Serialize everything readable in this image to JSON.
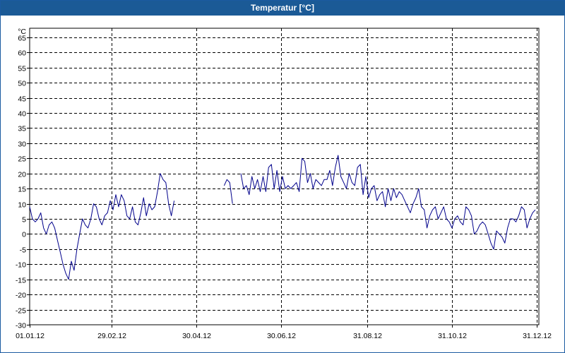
{
  "window": {
    "title": "Temperatur [°C]"
  },
  "chart_data": {
    "type": "line",
    "title": "Temperatur [°C]",
    "ylabel": "°C",
    "xlabel": "",
    "ylim": [
      -30,
      68
    ],
    "yticks": [
      -30,
      -25,
      -20,
      -15,
      -10,
      -5,
      0,
      5,
      10,
      15,
      20,
      25,
      30,
      35,
      40,
      45,
      50,
      55,
      60,
      65
    ],
    "xlim": [
      "2012-01-01",
      "2012-12-31"
    ],
    "xticks": [
      {
        "date": "2012-01-01",
        "label": "01.01.12"
      },
      {
        "date": "2012-02-29",
        "label": "29.02.12"
      },
      {
        "date": "2012-04-30",
        "label": "30.04.12"
      },
      {
        "date": "2012-06-30",
        "label": "30.06.12"
      },
      {
        "date": "2012-08-31",
        "label": "31.08.12"
      },
      {
        "date": "2012-10-31",
        "label": "31.10.12"
      },
      {
        "date": "2012-12-31",
        "label": "31.12.12"
      }
    ],
    "grid": true,
    "grid_style": "dashed",
    "line_color": "#00008b",
    "series": [
      {
        "segments": [
          {
            "x": [
              "2012-01-01",
              "2012-01-03",
              "2012-01-05",
              "2012-01-07",
              "2012-01-09",
              "2012-01-11",
              "2012-01-13",
              "2012-01-15",
              "2012-01-17",
              "2012-01-19",
              "2012-01-21",
              "2012-01-23",
              "2012-01-25",
              "2012-01-27",
              "2012-01-29",
              "2012-01-31",
              "2012-02-02",
              "2012-02-04",
              "2012-02-06",
              "2012-02-08",
              "2012-02-10",
              "2012-02-12",
              "2012-02-14",
              "2012-02-16",
              "2012-02-18",
              "2012-02-20",
              "2012-02-22",
              "2012-02-24",
              "2012-02-26",
              "2012-02-28",
              "2012-03-01",
              "2012-03-03",
              "2012-03-05",
              "2012-03-07",
              "2012-03-09",
              "2012-03-11",
              "2012-03-13",
              "2012-03-15",
              "2012-03-17",
              "2012-03-19",
              "2012-03-21",
              "2012-03-23",
              "2012-03-25",
              "2012-03-27",
              "2012-03-29",
              "2012-03-31",
              "2012-04-02",
              "2012-04-04",
              "2012-04-06",
              "2012-04-08",
              "2012-04-10",
              "2012-04-12",
              "2012-04-14",
              "2012-04-16",
              "2012-04-18",
              "2012-04-20",
              "2012-04-22",
              "2012-04-24",
              "2012-04-26",
              "2012-04-28",
              "2012-04-30",
              "2012-05-02",
              "2012-05-04",
              "2012-05-06",
              "2012-05-08",
              "2012-05-10"
            ],
            "y": [
              9,
              5,
              4,
              5,
              7,
              2,
              0,
              3,
              4,
              2,
              -2,
              -6,
              -10,
              -13,
              -15,
              -9,
              -12,
              -5,
              0,
              5,
              3,
              2,
              5,
              10,
              9,
              5,
              3,
              6,
              7,
              11,
              8,
              13,
              9,
              13,
              11,
              6,
              5,
              9,
              4,
              3,
              7,
              12,
              6,
              10,
              8,
              9,
              14,
              20,
              18,
              17,
              10,
              6,
              11,
              null,
              null,
              null,
              null,
              null,
              null,
              null,
              null,
              null,
              null,
              null,
              null,
              null
            ]
          },
          {
            "x": [
              "2012-05-20",
              "2012-05-22",
              "2012-05-24",
              "2012-05-26"
            ],
            "y": [
              16,
              18,
              17,
              10
            ]
          },
          {
            "x": [
              "2012-06-01",
              "2012-06-03",
              "2012-06-05",
              "2012-06-07",
              "2012-06-09",
              "2012-06-11",
              "2012-06-13",
              "2012-06-15",
              "2012-06-17",
              "2012-06-19",
              "2012-06-21",
              "2012-06-23",
              "2012-06-25",
              "2012-06-27",
              "2012-06-29",
              "2012-07-01",
              "2012-07-03",
              "2012-07-05",
              "2012-07-07",
              "2012-07-09",
              "2012-07-11",
              "2012-07-13",
              "2012-07-15",
              "2012-07-17",
              "2012-07-19",
              "2012-07-21",
              "2012-07-23",
              "2012-07-25",
              "2012-07-27",
              "2012-07-29",
              "2012-07-31",
              "2012-08-02",
              "2012-08-04",
              "2012-08-06",
              "2012-08-08",
              "2012-08-10",
              "2012-08-12",
              "2012-08-14",
              "2012-08-16",
              "2012-08-18",
              "2012-08-20",
              "2012-08-22",
              "2012-08-24",
              "2012-08-26",
              "2012-08-28",
              "2012-08-30",
              "2012-09-01",
              "2012-09-03",
              "2012-09-05",
              "2012-09-07",
              "2012-09-09",
              "2012-09-11",
              "2012-09-13",
              "2012-09-15",
              "2012-09-17",
              "2012-09-19",
              "2012-09-21",
              "2012-09-23",
              "2012-09-25",
              "2012-09-27",
              "2012-09-29",
              "2012-10-01",
              "2012-10-03",
              "2012-10-05",
              "2012-10-07",
              "2012-10-09",
              "2012-10-11",
              "2012-10-13",
              "2012-10-15",
              "2012-10-17",
              "2012-10-19",
              "2012-10-21",
              "2012-10-23",
              "2012-10-25",
              "2012-10-27",
              "2012-10-29",
              "2012-10-31",
              "2012-11-02",
              "2012-11-04",
              "2012-11-06",
              "2012-11-08",
              "2012-11-10",
              "2012-11-12",
              "2012-11-14",
              "2012-11-16",
              "2012-11-18",
              "2012-11-20",
              "2012-11-22",
              "2012-11-24",
              "2012-11-26",
              "2012-11-28",
              "2012-11-30",
              "2012-12-02",
              "2012-12-04",
              "2012-12-06",
              "2012-12-08",
              "2012-12-10",
              "2012-12-12",
              "2012-12-14",
              "2012-12-16",
              "2012-12-18",
              "2012-12-20",
              "2012-12-22",
              "2012-12-24",
              "2012-12-26",
              "2012-12-28",
              "2012-12-30"
            ],
            "y": [
              20,
              15,
              16,
              13,
              19,
              15,
              18,
              14,
              19,
              14,
              22,
              23,
              15,
              21,
              14,
              19,
              15,
              16,
              15,
              16,
              17,
              14,
              25,
              24,
              17,
              20,
              15,
              18,
              17,
              16,
              18,
              18,
              21,
              16,
              22,
              26,
              19,
              17,
              15,
              20,
              17,
              16,
              22,
              23,
              13,
              19,
              12,
              15,
              16,
              11,
              13,
              14,
              9,
              15,
              11,
              15,
              12,
              14,
              13,
              11,
              9,
              7,
              10,
              12,
              15,
              9,
              8,
              2,
              6,
              8,
              9,
              5,
              7,
              9,
              5,
              4,
              2,
              5,
              6,
              4,
              3,
              9,
              8,
              6,
              0,
              1,
              3,
              4,
              3,
              0,
              -3,
              -5,
              1,
              0,
              -1,
              -3,
              2,
              5,
              5,
              4,
              6,
              9,
              8,
              2,
              5,
              7,
              8
            ]
          }
        ]
      }
    ]
  }
}
